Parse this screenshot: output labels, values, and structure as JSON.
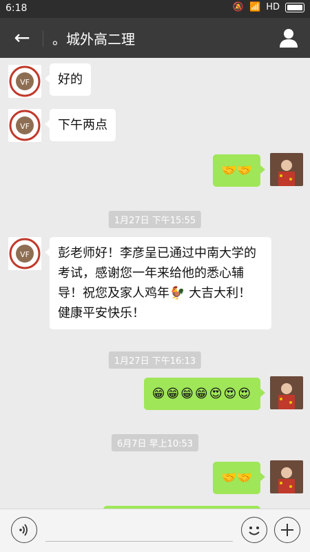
{
  "status_bar": {
    "time": "6:18",
    "network": "HD"
  },
  "header": {
    "back_label": "←",
    "title": "。城外高二理"
  },
  "colors": {
    "header_bg": "#3a3a3a",
    "green_bubble": "#9fe658",
    "white_bubble": "#ffffff"
  },
  "messages": [
    {
      "side": "left",
      "text": "好的"
    },
    {
      "side": "left",
      "text": "下午两点"
    },
    {
      "side": "right",
      "text": "🤝🤝"
    },
    {
      "type": "timestamp",
      "text": "1月27日 下午15:55"
    },
    {
      "side": "left",
      "text": "彭老师好！李彦呈已通过中南大学的考试，感谢您一年来给他的悉心辅导！祝您及家人鸡年🐓 大吉大利！健康平安快乐！"
    },
    {
      "type": "timestamp",
      "text": "1月27日 下午16:13"
    },
    {
      "side": "right",
      "text": "😁😁😁😁😍😍😍"
    },
    {
      "type": "timestamp",
      "text": "6月7日 早上10:53"
    },
    {
      "side": "right",
      "text": "🤝🤝"
    }
  ],
  "input_bar": {
    "voice_icon": "voice-icon",
    "emoji_icon": "emoji-icon",
    "plus_icon": "plus-icon"
  }
}
